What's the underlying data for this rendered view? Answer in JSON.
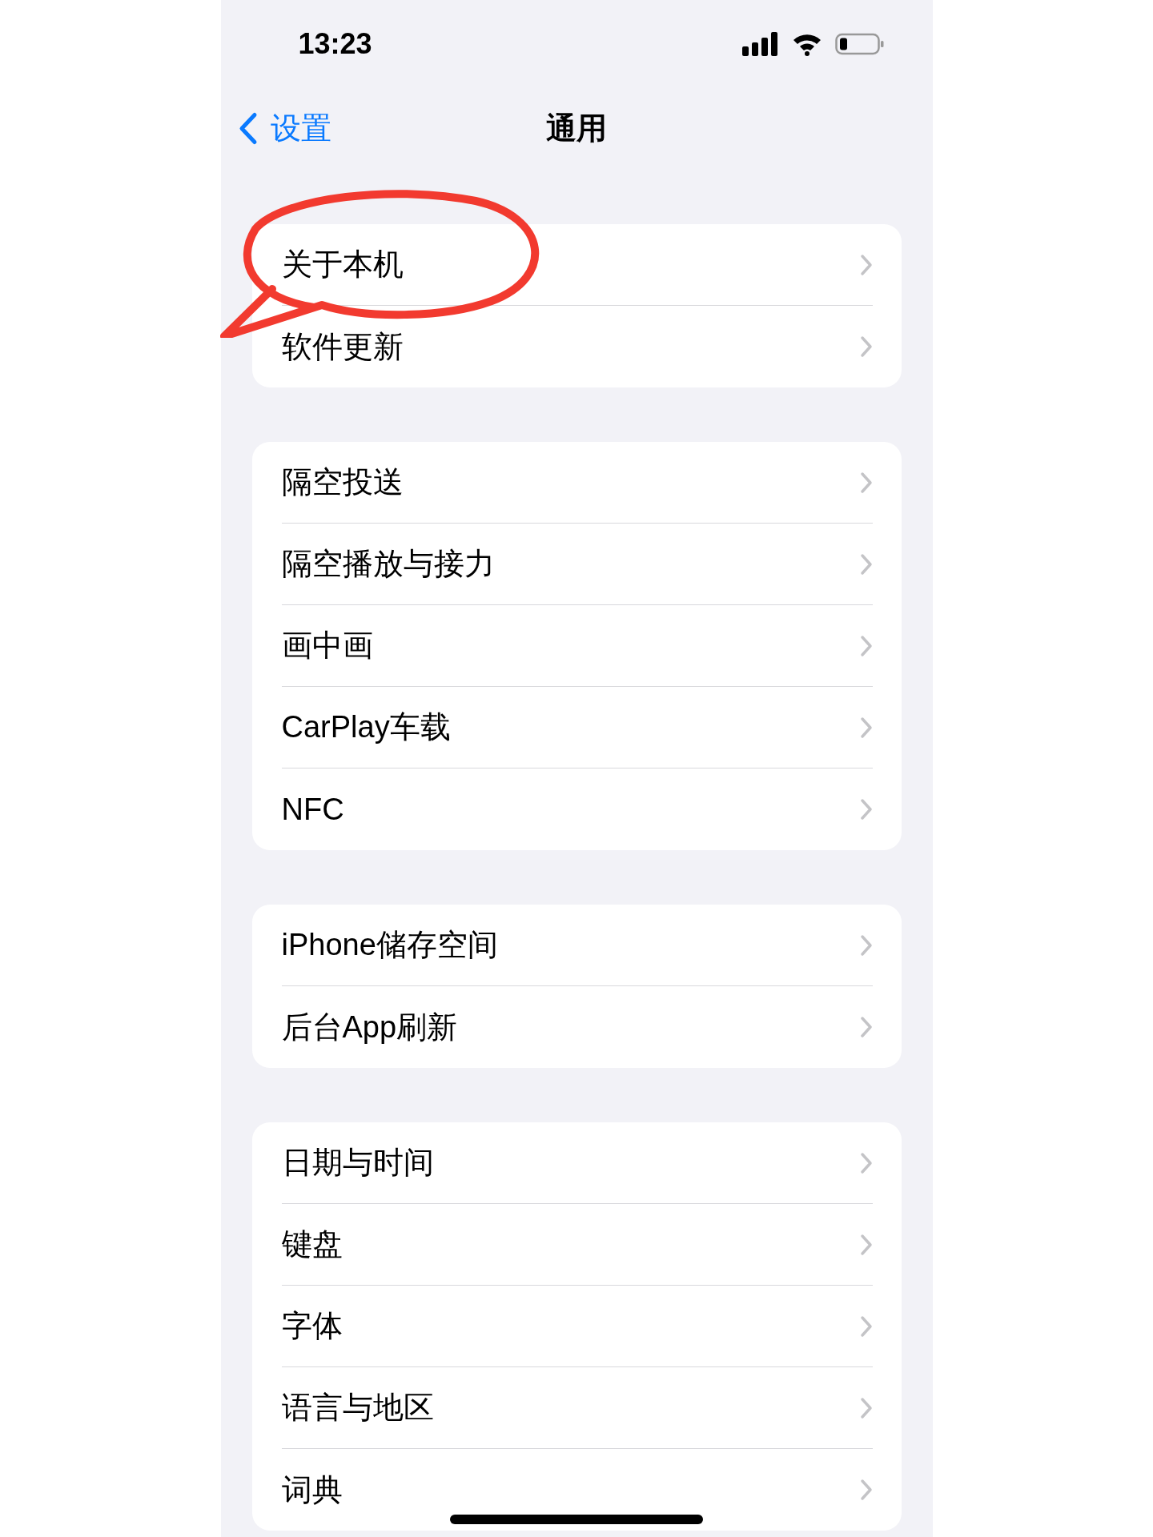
{
  "status_bar": {
    "time": "13:23"
  },
  "nav": {
    "back_label": "设置",
    "title": "通用"
  },
  "groups": [
    {
      "items": [
        {
          "label": "关于本机"
        },
        {
          "label": "软件更新"
        }
      ]
    },
    {
      "items": [
        {
          "label": "隔空投送"
        },
        {
          "label": "隔空播放与接力"
        },
        {
          "label": "画中画"
        },
        {
          "label": "CarPlay车载"
        },
        {
          "label": "NFC"
        }
      ]
    },
    {
      "items": [
        {
          "label": "iPhone储存空间"
        },
        {
          "label": "后台App刷新"
        }
      ]
    },
    {
      "items": [
        {
          "label": "日期与时间"
        },
        {
          "label": "键盘"
        },
        {
          "label": "字体"
        },
        {
          "label": "语言与地区"
        },
        {
          "label": "词典"
        }
      ]
    }
  ]
}
